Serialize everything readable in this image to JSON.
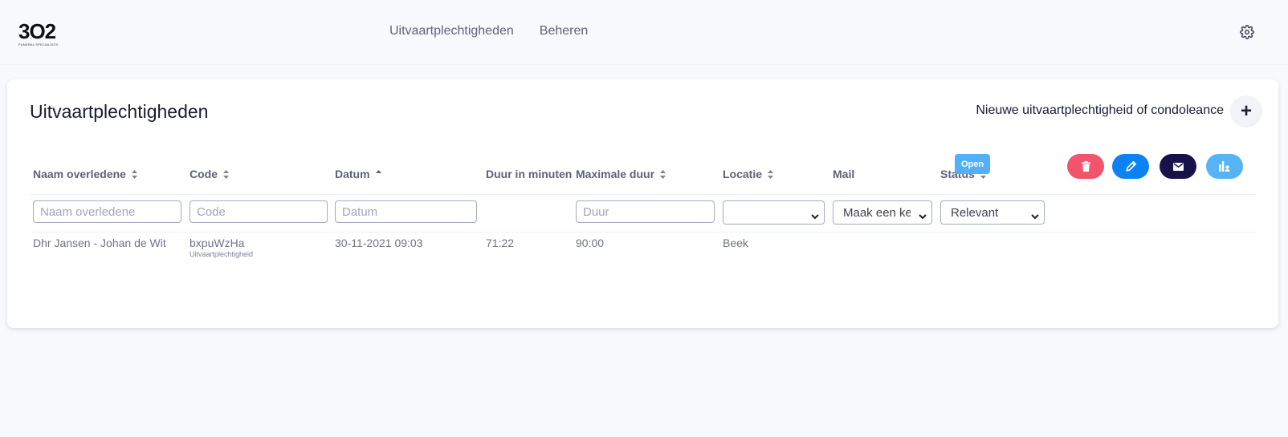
{
  "logo": {
    "text": "3O2",
    "subtitle": "FUNERAL SPECIALISTS"
  },
  "nav": [
    {
      "label": "Uitvaartplechtigheden"
    },
    {
      "label": "Beheren"
    }
  ],
  "page": {
    "title": "Uitvaartplechtigheden",
    "new_label": "Nieuwe uitvaartplechtigheid of condoleance"
  },
  "table": {
    "columns": [
      {
        "label": "Naam overledene",
        "sort": "both"
      },
      {
        "label": "Code",
        "sort": "both"
      },
      {
        "label": "Datum",
        "sort": "asc"
      },
      {
        "label": "Duur in minuten",
        "sort": "none"
      },
      {
        "label": "Maximale duur",
        "sort": "both"
      },
      {
        "label": "Locatie",
        "sort": "both"
      },
      {
        "label": "Mail",
        "sort": "none"
      },
      {
        "label": "Status",
        "sort": "both"
      }
    ],
    "filters": {
      "naam_placeholder": "Naam overledene",
      "code_placeholder": "Code",
      "datum_placeholder": "Datum",
      "duur_placeholder": "Duur",
      "locatie_value": "",
      "mail_value": "Maak een keuze",
      "status_value": "Relevant"
    },
    "rows": [
      {
        "naam": "Dhr Jansen - Johan de Wit",
        "code": "bxpuWzHa",
        "code_sub": "Uitvaartplechtigheid",
        "datum": "30-11-2021 09:03",
        "duur": "71:22",
        "max_duur": "90:00",
        "locatie": "Beek",
        "mail": "",
        "status": "Open"
      }
    ]
  },
  "colors": {
    "delete": "#f1556c",
    "edit": "#0d82f2",
    "mail": "#17124a",
    "report": "#56b4f5",
    "badge": "#50b1fa"
  },
  "icons": [
    "gear-icon",
    "plus-icon",
    "trash-icon",
    "pencil-icon",
    "envelope-icon",
    "report-icon"
  ]
}
